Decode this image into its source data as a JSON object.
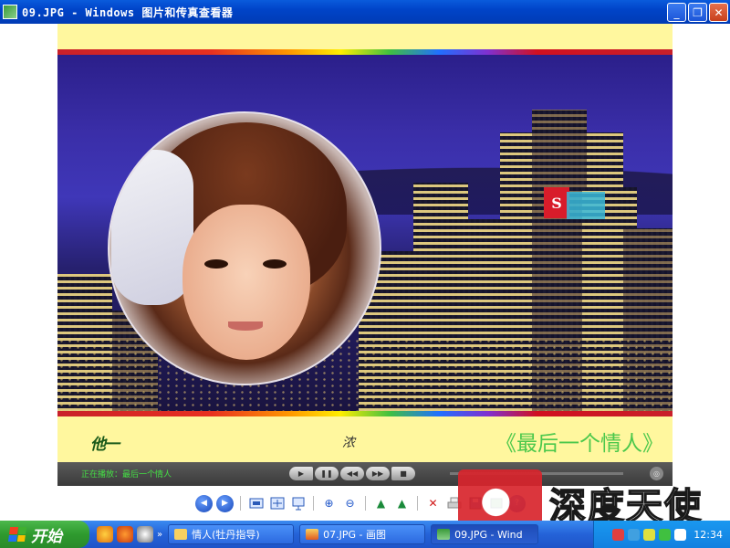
{
  "window": {
    "title": "09.JPG - Windows 图片和传真查看器",
    "minimize": "_",
    "restore": "❐",
    "close": "✕"
  },
  "movie": {
    "caption_left": "他一",
    "caption_mid": "浓",
    "caption_right": "《最后一个情人》",
    "neon_letter": "S",
    "now_playing": "正在播放：最后一个情人",
    "progress_fraction": 0.0
  },
  "player": {
    "play": "▶",
    "pause": "❚❚",
    "rewind": "◀◀",
    "forward": "▶▶",
    "stop": "■",
    "toggle": "◎"
  },
  "toolbar": {
    "prev": "◀",
    "next": "▶",
    "zoom_in": "⊕",
    "zoom_out": "⊖",
    "rotate_cw": "▲",
    "rotate_ccw": "▲",
    "delete": "✕",
    "help": "?"
  },
  "watermark": {
    "text": "深度天使"
  },
  "taskbar": {
    "start_label": "开始",
    "chevron": "»",
    "tasks": [
      {
        "label": "情人(牡丹指导)"
      },
      {
        "label": "07.JPG - 画图"
      },
      {
        "label": "09.JPG - Wind"
      }
    ],
    "clock": "12:34"
  },
  "colors": {
    "titlebar": "#0044c8",
    "movie_background": "#fff79e",
    "caption_green": "#4cc84c",
    "start_green": "#2e9a2e"
  }
}
